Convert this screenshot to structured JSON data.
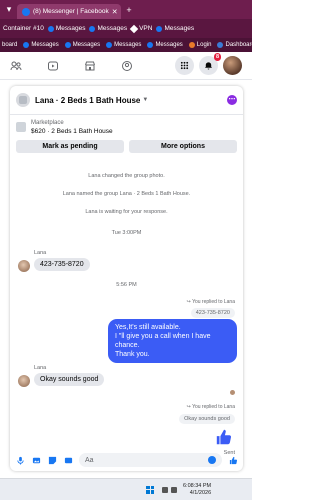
{
  "browser": {
    "tab_title": "(8) Messenger | Facebook",
    "container_label": "Container #10",
    "vpn_label": "VPN",
    "bookmarks": [
      "Messages",
      "Messages",
      "Messages",
      "Messages",
      "Login",
      "Dashboard"
    ],
    "bookmarks_prefix": "board",
    "addr_bookmarks": [
      "Messages",
      "Messages",
      "Messages"
    ]
  },
  "fb_nav": {
    "notification_count": "8"
  },
  "chat": {
    "title": "Lana · 2 Beds 1 Bath House",
    "marketplace_label": "Marketplace",
    "marketplace_item": "$620 · 2 Beds 1 Bath House",
    "mark_pending_label": "Mark as pending",
    "more_options_label": "More options",
    "system_messages": [
      "Lana changed the group photo.",
      "Lana named the group Lana · 2 Beds 1 Bath House.",
      "Lana is waiting for your response."
    ],
    "time_1": "Tue 3:00PM",
    "sender_1": "Lana",
    "message_1": "423-735-8720",
    "time_2": "5:56 PM",
    "reply_note_1": "You replied to Lana",
    "quoted_1": "423-735-8720",
    "my_message_line_1": "Yes,It's still available.",
    "my_message_line_2": "I \"ll give you a call when I have chance.",
    "my_message_line_3": "Thank you.",
    "sender_2": "Lana",
    "message_2": "Okay sounds good",
    "reply_note_2": "You replied to Lana",
    "quoted_2": "Okay sounds good",
    "sent_label": "Sent",
    "composer_placeholder": "Aa"
  },
  "taskbar": {
    "time": "6:08:34 PM",
    "date": "4/1/2026"
  },
  "colors": {
    "browser_tabbar": "#6e1e4e",
    "brand_blue": "#1877f2",
    "outgoing_bubble": "#3b5cf5"
  }
}
